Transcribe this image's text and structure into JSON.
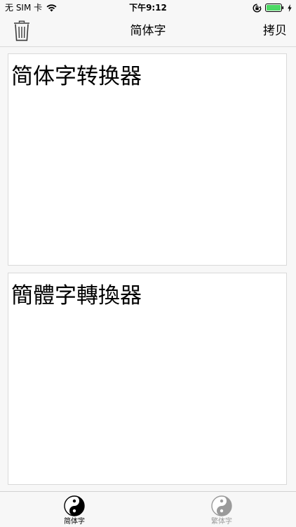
{
  "status": {
    "carrier": "无 SIM 卡",
    "time": "下午9:12"
  },
  "nav": {
    "title": "简体字",
    "copy_label": "拷贝",
    "trash_icon": "trash-icon"
  },
  "boxes": {
    "simplified_text": "简体字转换器",
    "traditional_text": "簡體字轉換器"
  },
  "tabs": [
    {
      "label": "简体字",
      "icon": "yin-yang-icon",
      "selected": true
    },
    {
      "label": "繁体字",
      "icon": "yin-yang-icon",
      "selected": false
    }
  ],
  "colors": {
    "background": "#f7f7f7",
    "selected_tab": "#000000",
    "unselected_tab": "#9a9a9a",
    "battery": "#4cd964"
  }
}
